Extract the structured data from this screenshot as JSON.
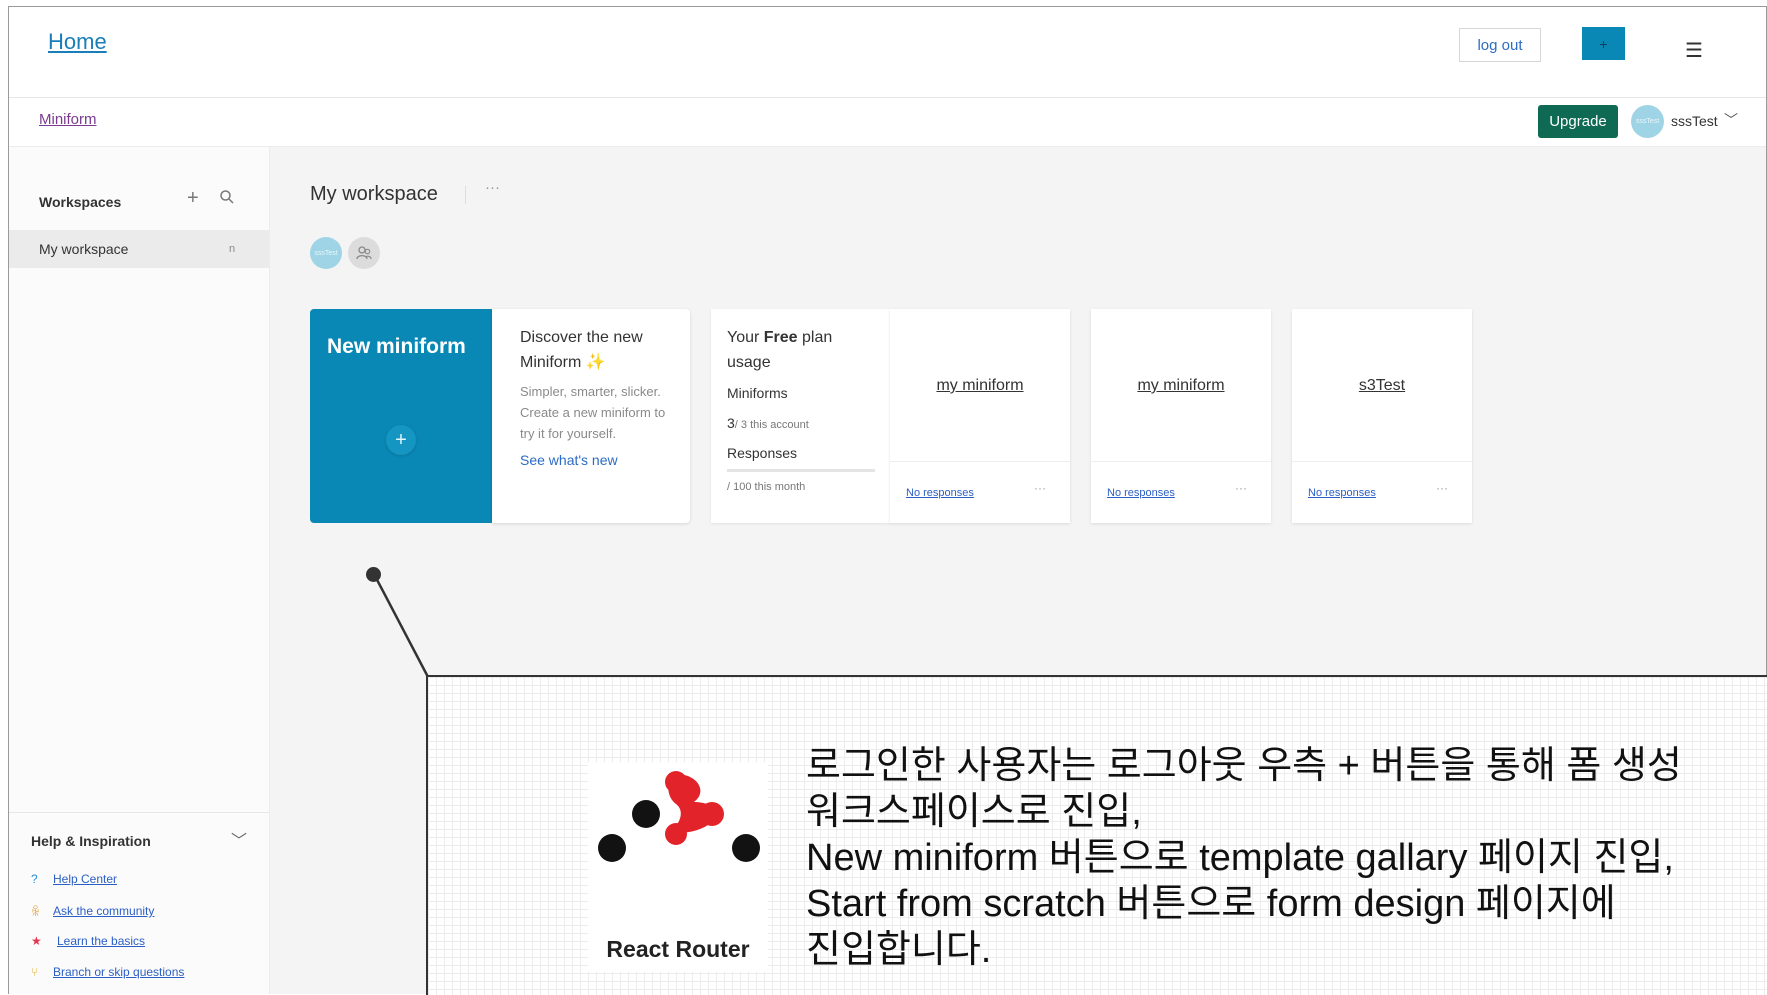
{
  "topbar": {
    "home_label": "Home",
    "logout_label": "log out",
    "plus_label": "+",
    "menu_icon": "hamburger-icon"
  },
  "subbar": {
    "brand_label": "Miniform",
    "upgrade_label": "Upgrade",
    "user_name": "sssTest",
    "avatar_text": "sssTest"
  },
  "sidebar": {
    "workspaces_title": "Workspaces",
    "workspaces": [
      {
        "label": "My workspace",
        "badge": "n"
      }
    ],
    "help_title": "Help & Inspiration",
    "help_items": [
      {
        "label": "Help Center",
        "icon": "question-icon",
        "glyph": "?"
      },
      {
        "label": "Ask the community",
        "icon": "community-icon",
        "glyph": "ꆜ"
      },
      {
        "label": "Learn the basics",
        "icon": "star-icon",
        "glyph": "★"
      },
      {
        "label": "Branch or skip questions",
        "icon": "branch-icon",
        "glyph": "⑂"
      }
    ]
  },
  "main": {
    "workspace_title": "My workspace",
    "more_label": "···",
    "member_avatar_text": "sssTest",
    "new_card": {
      "title": "New miniform",
      "plus": "+"
    },
    "discover_card": {
      "title": "Discover the new Miniform",
      "sparkle": "✨",
      "description": "Simpler, smarter, slicker. Create a new miniform to try it for yourself.",
      "link": "See what's new"
    },
    "usage_card": {
      "title_prefix": "Your ",
      "title_bold": "Free",
      "title_suffix": " plan usage",
      "miniforms_label": "Miniforms",
      "miniforms_count": "3",
      "miniforms_limit": "/ 3 this account",
      "responses_label": "Responses",
      "responses_limit": "/ 100 this month"
    },
    "forms": [
      {
        "title": "my miniform",
        "responses": "No responses",
        "more": "···"
      },
      {
        "title": "my miniform",
        "responses": "No responses",
        "more": "···"
      },
      {
        "title": "s3Test",
        "responses": "No responses",
        "more": "···"
      }
    ]
  },
  "callout": {
    "logo_name": "React Router",
    "colors": {
      "red": "#e2232a",
      "black": "#121212"
    },
    "text": "로그인한 사용자는 로그아웃 우측 + 버튼을 통해 폼 생성\n워크스페이스로 진입,\nNew miniform 버튼으로 template gallary 페이지 진입,\nStart from scratch 버튼으로 form design 페이지에\n진입합니다."
  }
}
